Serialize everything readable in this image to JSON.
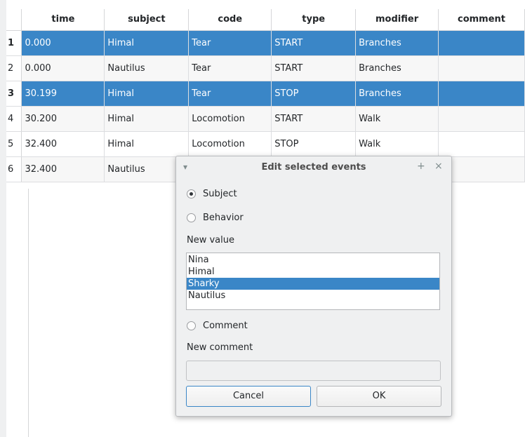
{
  "table": {
    "columns": [
      "time",
      "subject",
      "code",
      "type",
      "modifier",
      "comment"
    ],
    "rows": [
      {
        "num": "1",
        "time": "0.000",
        "subject": "Himal",
        "code": "Tear",
        "type": "START",
        "modifier": "Branches",
        "comment": "",
        "selected": true
      },
      {
        "num": "2",
        "time": "0.000",
        "subject": "Nautilus",
        "code": "Tear",
        "type": "START",
        "modifier": "Branches",
        "comment": "",
        "selected": false
      },
      {
        "num": "3",
        "time": "30.199",
        "subject": "Himal",
        "code": "Tear",
        "type": "STOP",
        "modifier": "Branches",
        "comment": "",
        "selected": true
      },
      {
        "num": "4",
        "time": "30.200",
        "subject": "Himal",
        "code": "Locomotion",
        "type": "START",
        "modifier": "Walk",
        "comment": "",
        "selected": false
      },
      {
        "num": "5",
        "time": "32.400",
        "subject": "Himal",
        "code": "Locomotion",
        "type": "STOP",
        "modifier": "Walk",
        "comment": "",
        "selected": false
      },
      {
        "num": "6",
        "time": "32.400",
        "subject": "Nautilus",
        "code": "",
        "type": "",
        "modifier": "",
        "comment": "",
        "selected": false
      }
    ]
  },
  "dialog": {
    "title": "Edit selected events",
    "menu_icon": "▾",
    "float_icon": "+",
    "close_icon": "×",
    "subject_label": "Subject",
    "subject_checked": true,
    "behavior_label": "Behavior",
    "behavior_checked": false,
    "new_value_label": "New value",
    "values": [
      "Nina",
      "Himal",
      "Sharky",
      "Nautilus"
    ],
    "selected_value": "Sharky",
    "comment_label": "Comment",
    "comment_checked": false,
    "new_comment_label": "New comment",
    "new_comment_value": "",
    "cancel_label": "Cancel",
    "ok_label": "OK"
  },
  "colors": {
    "selection": "#3a86c7",
    "window_bg": "#eff0f1"
  }
}
